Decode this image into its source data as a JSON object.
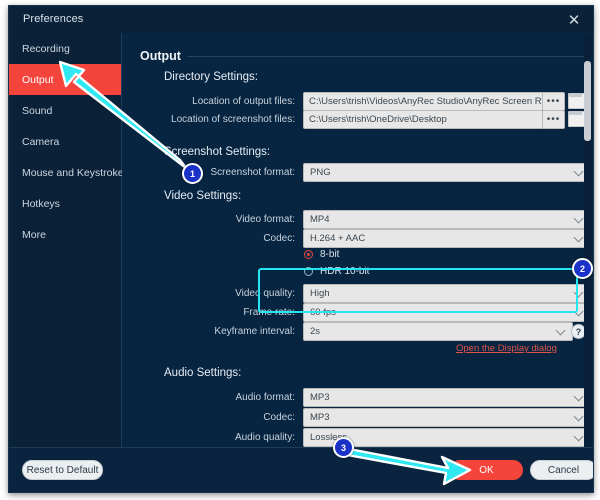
{
  "window": {
    "title": "Preferences",
    "close_icon": "close-icon"
  },
  "sidebar": {
    "items": [
      {
        "label": "Recording",
        "active": false
      },
      {
        "label": "Output",
        "active": true
      },
      {
        "label": "Sound",
        "active": false
      },
      {
        "label": "Camera",
        "active": false
      },
      {
        "label": "Mouse and Keystroke",
        "active": false
      },
      {
        "label": "Hotkeys",
        "active": false
      },
      {
        "label": "More",
        "active": false
      }
    ]
  },
  "main": {
    "page_title": "Output",
    "directory_settings": {
      "heading": "Directory Settings:",
      "output_files_label": "Location of output files:",
      "output_files_value": "C:\\Users\\trish\\Videos\\AnyRec Studio\\AnyRec Screen Recor",
      "screenshot_files_label": "Location of screenshot files:",
      "screenshot_files_value": "C:\\Users\\trish\\OneDrive\\Desktop",
      "browse_dots_label": "•••",
      "folder_icon": "folder-icon"
    },
    "screenshot_settings": {
      "heading": "Screenshot Settings:",
      "format_label": "Screenshot format:",
      "format_value": "PNG"
    },
    "video_settings": {
      "heading": "Video Settings:",
      "format_label": "Video format:",
      "format_value": "MP4",
      "codec_label": "Codec:",
      "codec_value": "H.264 + AAC",
      "bitdepth_8": "8-bit",
      "bitdepth_8_selected": true,
      "bitdepth_hdr": "HDR 10-bit",
      "bitdepth_hdr_selected": false,
      "quality_label": "Video quality:",
      "quality_value": "High",
      "framerate_label": "Frame rate:",
      "framerate_value": "60 fps",
      "keyframe_label": "Keyframe interval:",
      "keyframe_value": "2s",
      "help_glyph": "?",
      "display_dialog_link": "Open the Display dialog"
    },
    "audio_settings": {
      "heading": "Audio Settings:",
      "format_label": "Audio format:",
      "format_value": "MP3",
      "codec_label": "Codec:",
      "codec_value": "MP3",
      "quality_label": "Audio quality:",
      "quality_value": "Lossless"
    }
  },
  "footer": {
    "reset_label": "Reset to Default",
    "ok_label": "OK",
    "cancel_label": "Cancel"
  },
  "annotations": {
    "badge_1": "1",
    "badge_2": "2",
    "badge_3": "3"
  },
  "colors": {
    "accent_red": "#f4443c",
    "panel_navy": "#072440",
    "sidebar_navy": "#0b2138",
    "highlight_cyan": "#23e6f0",
    "badge_blue": "#1a32c8",
    "link_red": "#e0564b"
  }
}
